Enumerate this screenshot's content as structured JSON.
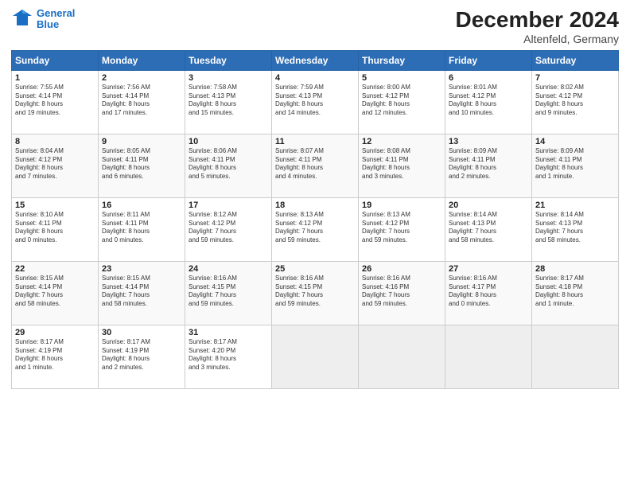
{
  "header": {
    "logo_line1": "General",
    "logo_line2": "Blue",
    "title": "December 2024",
    "subtitle": "Altenfeld, Germany"
  },
  "days_of_week": [
    "Sunday",
    "Monday",
    "Tuesday",
    "Wednesday",
    "Thursday",
    "Friday",
    "Saturday"
  ],
  "weeks": [
    {
      "row_class": "week-odd",
      "days": [
        {
          "num": "1",
          "info": "Sunrise: 7:55 AM\nSunset: 4:14 PM\nDaylight: 8 hours\nand 19 minutes.",
          "empty": false
        },
        {
          "num": "2",
          "info": "Sunrise: 7:56 AM\nSunset: 4:14 PM\nDaylight: 8 hours\nand 17 minutes.",
          "empty": false
        },
        {
          "num": "3",
          "info": "Sunrise: 7:58 AM\nSunset: 4:13 PM\nDaylight: 8 hours\nand 15 minutes.",
          "empty": false
        },
        {
          "num": "4",
          "info": "Sunrise: 7:59 AM\nSunset: 4:13 PM\nDaylight: 8 hours\nand 14 minutes.",
          "empty": false
        },
        {
          "num": "5",
          "info": "Sunrise: 8:00 AM\nSunset: 4:12 PM\nDaylight: 8 hours\nand 12 minutes.",
          "empty": false
        },
        {
          "num": "6",
          "info": "Sunrise: 8:01 AM\nSunset: 4:12 PM\nDaylight: 8 hours\nand 10 minutes.",
          "empty": false
        },
        {
          "num": "7",
          "info": "Sunrise: 8:02 AM\nSunset: 4:12 PM\nDaylight: 8 hours\nand 9 minutes.",
          "empty": false
        }
      ]
    },
    {
      "row_class": "week-even",
      "days": [
        {
          "num": "8",
          "info": "Sunrise: 8:04 AM\nSunset: 4:12 PM\nDaylight: 8 hours\nand 7 minutes.",
          "empty": false
        },
        {
          "num": "9",
          "info": "Sunrise: 8:05 AM\nSunset: 4:11 PM\nDaylight: 8 hours\nand 6 minutes.",
          "empty": false
        },
        {
          "num": "10",
          "info": "Sunrise: 8:06 AM\nSunset: 4:11 PM\nDaylight: 8 hours\nand 5 minutes.",
          "empty": false
        },
        {
          "num": "11",
          "info": "Sunrise: 8:07 AM\nSunset: 4:11 PM\nDaylight: 8 hours\nand 4 minutes.",
          "empty": false
        },
        {
          "num": "12",
          "info": "Sunrise: 8:08 AM\nSunset: 4:11 PM\nDaylight: 8 hours\nand 3 minutes.",
          "empty": false
        },
        {
          "num": "13",
          "info": "Sunrise: 8:09 AM\nSunset: 4:11 PM\nDaylight: 8 hours\nand 2 minutes.",
          "empty": false
        },
        {
          "num": "14",
          "info": "Sunrise: 8:09 AM\nSunset: 4:11 PM\nDaylight: 8 hours\nand 1 minute.",
          "empty": false
        }
      ]
    },
    {
      "row_class": "week-odd",
      "days": [
        {
          "num": "15",
          "info": "Sunrise: 8:10 AM\nSunset: 4:11 PM\nDaylight: 8 hours\nand 0 minutes.",
          "empty": false
        },
        {
          "num": "16",
          "info": "Sunrise: 8:11 AM\nSunset: 4:11 PM\nDaylight: 8 hours\nand 0 minutes.",
          "empty": false
        },
        {
          "num": "17",
          "info": "Sunrise: 8:12 AM\nSunset: 4:12 PM\nDaylight: 7 hours\nand 59 minutes.",
          "empty": false
        },
        {
          "num": "18",
          "info": "Sunrise: 8:13 AM\nSunset: 4:12 PM\nDaylight: 7 hours\nand 59 minutes.",
          "empty": false
        },
        {
          "num": "19",
          "info": "Sunrise: 8:13 AM\nSunset: 4:12 PM\nDaylight: 7 hours\nand 59 minutes.",
          "empty": false
        },
        {
          "num": "20",
          "info": "Sunrise: 8:14 AM\nSunset: 4:13 PM\nDaylight: 7 hours\nand 58 minutes.",
          "empty": false
        },
        {
          "num": "21",
          "info": "Sunrise: 8:14 AM\nSunset: 4:13 PM\nDaylight: 7 hours\nand 58 minutes.",
          "empty": false
        }
      ]
    },
    {
      "row_class": "week-even",
      "days": [
        {
          "num": "22",
          "info": "Sunrise: 8:15 AM\nSunset: 4:14 PM\nDaylight: 7 hours\nand 58 minutes.",
          "empty": false
        },
        {
          "num": "23",
          "info": "Sunrise: 8:15 AM\nSunset: 4:14 PM\nDaylight: 7 hours\nand 58 minutes.",
          "empty": false
        },
        {
          "num": "24",
          "info": "Sunrise: 8:16 AM\nSunset: 4:15 PM\nDaylight: 7 hours\nand 59 minutes.",
          "empty": false
        },
        {
          "num": "25",
          "info": "Sunrise: 8:16 AM\nSunset: 4:15 PM\nDaylight: 7 hours\nand 59 minutes.",
          "empty": false
        },
        {
          "num": "26",
          "info": "Sunrise: 8:16 AM\nSunset: 4:16 PM\nDaylight: 7 hours\nand 59 minutes.",
          "empty": false
        },
        {
          "num": "27",
          "info": "Sunrise: 8:16 AM\nSunset: 4:17 PM\nDaylight: 8 hours\nand 0 minutes.",
          "empty": false
        },
        {
          "num": "28",
          "info": "Sunrise: 8:17 AM\nSunset: 4:18 PM\nDaylight: 8 hours\nand 1 minute.",
          "empty": false
        }
      ]
    },
    {
      "row_class": "week-odd",
      "days": [
        {
          "num": "29",
          "info": "Sunrise: 8:17 AM\nSunset: 4:19 PM\nDaylight: 8 hours\nand 1 minute.",
          "empty": false
        },
        {
          "num": "30",
          "info": "Sunrise: 8:17 AM\nSunset: 4:19 PM\nDaylight: 8 hours\nand 2 minutes.",
          "empty": false
        },
        {
          "num": "31",
          "info": "Sunrise: 8:17 AM\nSunset: 4:20 PM\nDaylight: 8 hours\nand 3 minutes.",
          "empty": false
        },
        {
          "num": "",
          "info": "",
          "empty": true
        },
        {
          "num": "",
          "info": "",
          "empty": true
        },
        {
          "num": "",
          "info": "",
          "empty": true
        },
        {
          "num": "",
          "info": "",
          "empty": true
        }
      ]
    }
  ]
}
